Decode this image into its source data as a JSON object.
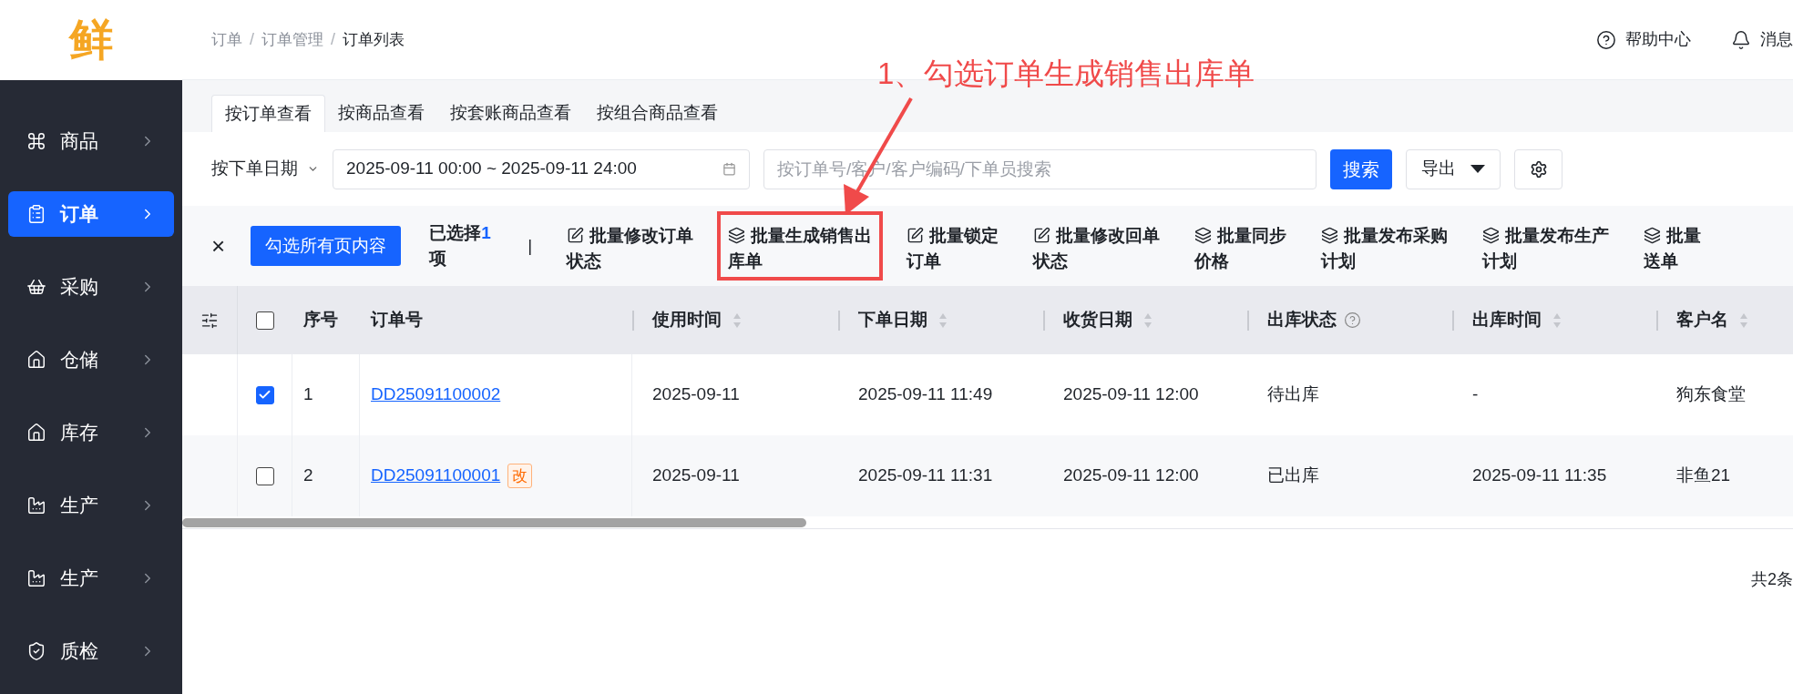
{
  "logo": {
    "text": "鲜"
  },
  "sidebar": {
    "items": [
      {
        "label": "商品",
        "selected": false
      },
      {
        "label": "订单",
        "selected": true
      },
      {
        "label": "采购",
        "selected": false
      },
      {
        "label": "仓储",
        "selected": false
      },
      {
        "label": "库存",
        "selected": false
      },
      {
        "label": "生产",
        "selected": false
      },
      {
        "label": "生产",
        "selected": false
      },
      {
        "label": "质检",
        "selected": false
      }
    ]
  },
  "breadcrumb": {
    "items": [
      "订单",
      "订单管理",
      "订单列表"
    ],
    "separator": "/"
  },
  "header_actions": [
    {
      "label": "帮助中心"
    },
    {
      "label": "消息"
    }
  ],
  "tabs": [
    {
      "label": "按订单查看",
      "selected": true
    },
    {
      "label": "按商品查看",
      "selected": false
    },
    {
      "label": "按套账商品查看",
      "selected": false
    },
    {
      "label": "按组合商品查看",
      "selected": false
    }
  ],
  "filters": {
    "date_type": "按下单日期",
    "date_range": "2025-09-11 00:00 ~ 2025-09-11 24:00",
    "search": {
      "placeholder": "按订单号/客户/客户编码/下单员搜索"
    },
    "search_button": "搜索",
    "export_button": "导出"
  },
  "bulk_bar": {
    "close": "×",
    "select_all_button": "勾选所有页内容",
    "selected_prefix": "已选择",
    "selected_count": "1",
    "selected_suffix": "项",
    "separator": "|",
    "actions": [
      {
        "kind": "edit",
        "lines": [
          "批量修改订单",
          "状态"
        ],
        "highlighted": false
      },
      {
        "kind": "generate",
        "lines": [
          "批量生成销售出",
          "库单"
        ],
        "highlighted": true
      },
      {
        "kind": "edit",
        "lines": [
          "批量锁定",
          "订单"
        ],
        "highlighted": false
      },
      {
        "kind": "edit",
        "lines": [
          "批量修改回单",
          "状态"
        ],
        "highlighted": false
      },
      {
        "kind": "generate",
        "lines": [
          "批量同步",
          "价格"
        ],
        "highlighted": false
      },
      {
        "kind": "generate",
        "lines": [
          "批量发布采购",
          "计划"
        ],
        "highlighted": false
      },
      {
        "kind": "generate",
        "lines": [
          "批量发布生产",
          "计划"
        ],
        "highlighted": false
      },
      {
        "kind": "generate",
        "lines": [
          "批量",
          "送单"
        ],
        "highlighted": false
      }
    ]
  },
  "table": {
    "header_checked": false,
    "columns": [
      {
        "label": "序号",
        "kind": "plain"
      },
      {
        "label": "订单号",
        "kind": "plain"
      },
      {
        "label": "使用时间",
        "kind": "sortable"
      },
      {
        "label": "下单日期",
        "kind": "sortable"
      },
      {
        "label": "收货日期",
        "kind": "sortable"
      },
      {
        "label": "出库状态",
        "kind": "help"
      },
      {
        "label": "出库时间",
        "kind": "sortable"
      },
      {
        "label": "客户名",
        "kind": "sortable"
      }
    ],
    "rows": [
      {
        "selected": true,
        "cells": [
          "1",
          "DD25091100002",
          "2025-09-11",
          "2025-09-11 11:49",
          "2025-09-11 12:00",
          "待出库",
          "-",
          "狗东食堂"
        ]
      },
      {
        "selected": false,
        "tag": "改",
        "cells": [
          "2",
          "DD25091100001",
          "2025-09-11",
          "2025-09-11 11:31",
          "2025-09-11 12:00",
          "已出库",
          "2025-09-11 11:35",
          "非鱼21"
        ]
      }
    ]
  },
  "pagination": {
    "total": "共2条"
  },
  "annotation": {
    "text": "1、勾选订单生成销售出库单"
  }
}
